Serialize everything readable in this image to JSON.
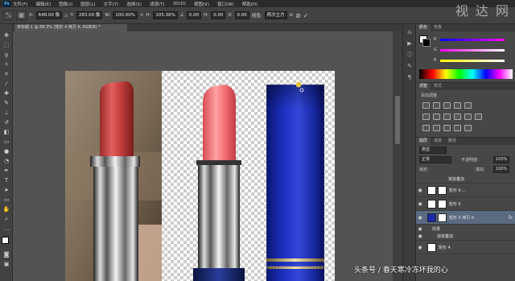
{
  "menubar": {
    "logo": "Ps",
    "items": [
      "文件(F)",
      "编辑(E)",
      "图像(I)",
      "图层(L)",
      "文字(Y)",
      "选择(S)",
      "滤镜(T)",
      "3D(D)",
      "视图(V)",
      "窗口(W)",
      "帮助(H)"
    ]
  },
  "options": {
    "x_label": "X:",
    "x_value": "648.00 像",
    "y_label": "Y:",
    "y_value": "283.00 像",
    "w_label": "W:",
    "w_value": "100.00%",
    "h_label": "H:",
    "h_value": "105.36%",
    "angle_value": "0.00",
    "hskew_label": "H:",
    "hskew_value": "0.00",
    "vskew_label": "V:",
    "vskew_value": "0.00",
    "interp_label": "插值:",
    "interp_value": "两次立方"
  },
  "watermark": "视 达 网",
  "document_tab": "未标题-1 @ 88.3% (矩形 4 拷贝 6, RGB/8) *",
  "color_panel": {
    "tabs": [
      "颜色",
      "色板"
    ],
    "r_label": "R",
    "g_label": "G",
    "b_label": "B"
  },
  "adjust_panel": {
    "tabs": [
      "调整",
      "样式"
    ],
    "title": "添加调整"
  },
  "layers_panel": {
    "tabs": [
      "图层",
      "通道",
      "路径"
    ],
    "kind_label": "类型",
    "blend_mode": "正常",
    "opacity_label": "不透明度:",
    "opacity_value": "100%",
    "lock_label": "锁定:",
    "fill_label": "填充:",
    "fill_value": "100%",
    "layers": [
      {
        "name": "渐变叠加",
        "type": "effect-label"
      },
      {
        "name": "矩形 6 ...",
        "type": "layer"
      },
      {
        "name": "矩形 6",
        "type": "layer"
      },
      {
        "name": "矩形 4 拷贝 6",
        "type": "layer",
        "selected": true,
        "fx": "fx"
      },
      {
        "name": "效果",
        "type": "sub"
      },
      {
        "name": "渐变叠加",
        "type": "sub"
      },
      {
        "name": "矩形 4",
        "type": "layer"
      }
    ]
  },
  "caption": "头条号 / 春天寒冷冻坏我的心"
}
